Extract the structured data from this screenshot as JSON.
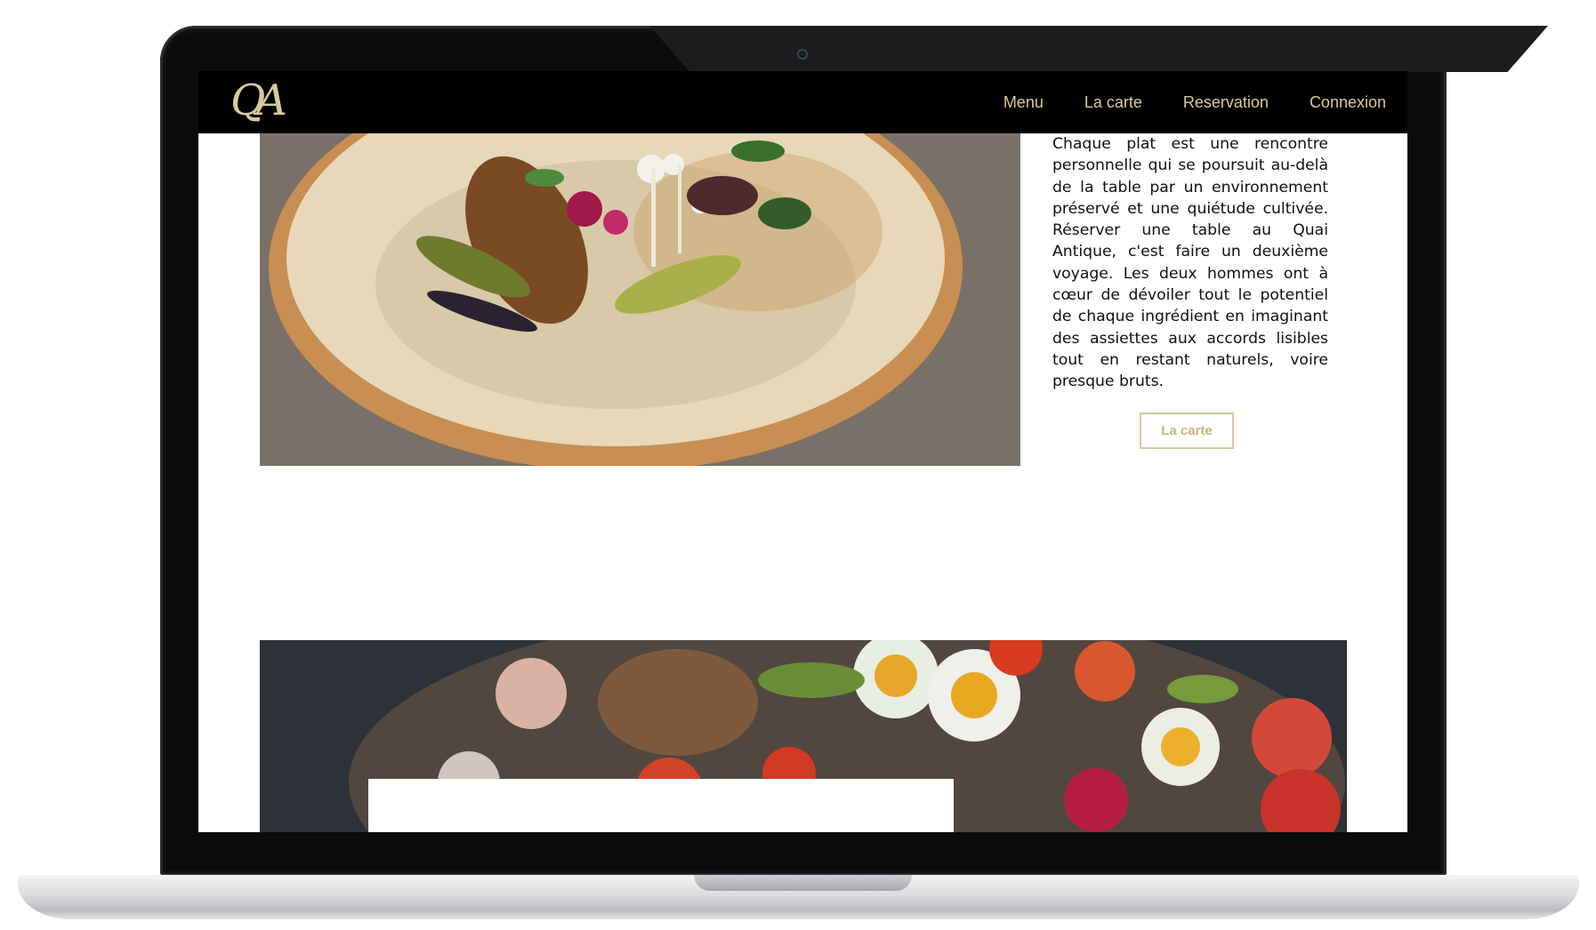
{
  "brand": {
    "logo_text": "QA"
  },
  "nav": {
    "items": [
      {
        "label": "Menu"
      },
      {
        "label": "La carte"
      },
      {
        "label": "Reservation"
      },
      {
        "label": "Connexion"
      }
    ]
  },
  "intro": {
    "paragraph": "Chaque plat est une rencontre personnelle qui se poursuit au-delà de la table par un environnement préservé et une quiétude cultivée. Réserver une table au Quai Antique, c'est faire un deuxième voyage. Les deux hommes ont à cœur de dévoiler tout le potentiel de chaque ingrédient en imaginant des assiettes aux accords lisibles tout en restant naturels, voire presque bruts.",
    "button_label": "La carte"
  },
  "overlay_card": {
    "title": ""
  },
  "colors": {
    "accent_gold": "#d9c99b",
    "navbar_bg": "#000000",
    "page_bg": "#ffffff"
  }
}
